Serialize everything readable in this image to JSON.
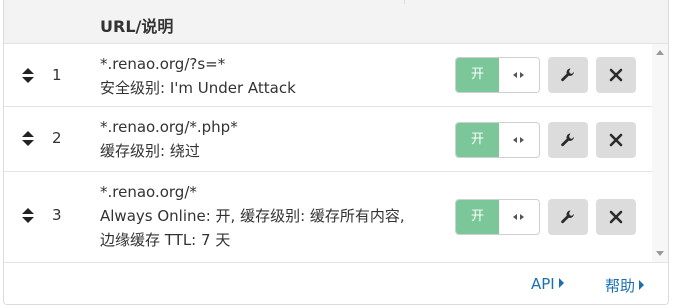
{
  "header": {
    "title": "URL/说明"
  },
  "rules": [
    {
      "index": "1",
      "lines": [
        "*.renao.org/?s=*",
        "安全级别: I'm Under Attack"
      ],
      "toggle_label": "开"
    },
    {
      "index": "2",
      "lines": [
        "*.renao.org/*.php*",
        "缓存级别: 绕过"
      ],
      "toggle_label": "开"
    },
    {
      "index": "3",
      "lines": [
        "*.renao.org/*",
        "Always Online: 开, 缓存级别: 缓存所有内容,",
        "边缘缓存 TTL: 7 天"
      ],
      "toggle_label": "开"
    }
  ],
  "footer": {
    "api_label": "API",
    "help_label": "帮助"
  },
  "colors": {
    "toggle_on": "#7bc79a",
    "link": "#1a6fb0",
    "icon_button": "#dcdcdc"
  },
  "icons": {
    "drag": "sort-icon",
    "edit": "wrench-icon",
    "delete": "close-icon",
    "toggle_knob": "code-icon",
    "link_caret": "caret-right-icon"
  }
}
